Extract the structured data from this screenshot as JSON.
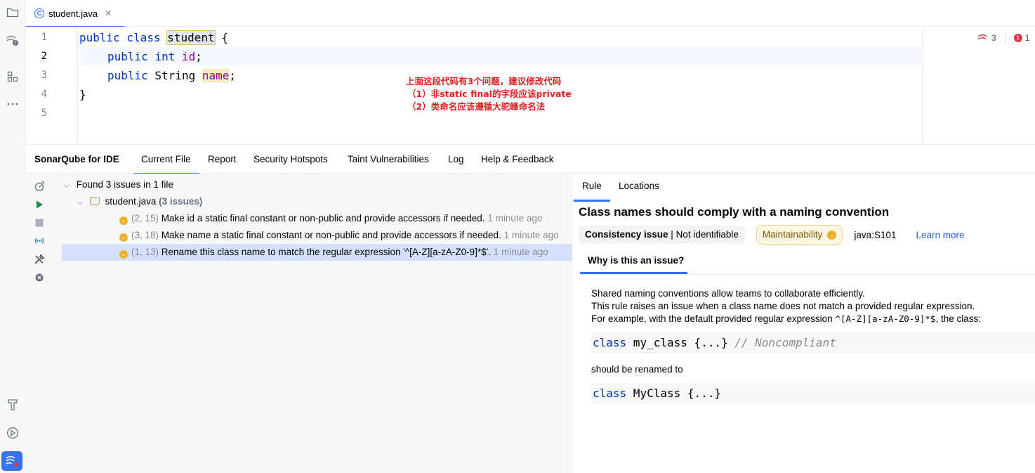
{
  "editor": {
    "tab_label": "student.java",
    "line_numbers": [
      "1",
      "2",
      "3",
      "4",
      "5"
    ],
    "code": {
      "l1_kw1": "public",
      "l1_kw2": "class",
      "l1_name": "student",
      "l1_brace": " {",
      "l2_kw1": "public",
      "l2_kw2": "int",
      "l2_field": "id",
      "l2_semi": ";",
      "l3_kw1": "public",
      "l3_type": " String ",
      "l3_field": "name",
      "l3_semi": ";",
      "l4_close": "}"
    },
    "annotation": [
      "上面这段代码有3个问题，建议修改代码",
      "（1）非static final的字段应该private",
      "（2）类命名应该遵循大驼峰命名法"
    ],
    "inspections": {
      "warnings": "3",
      "errors": "1"
    }
  },
  "tool_window": {
    "title": "SonarQube for IDE",
    "tabs": [
      "Current File",
      "Report",
      "Security Hotspots",
      "Taint Vulnerabilities",
      "Log",
      "Help & Feedback"
    ],
    "tree": {
      "summary": "Found 3 issues in 1 file",
      "file_name": "student.java",
      "file_count": "(3 issues)",
      "issues": [
        {
          "pos": "(2, 15)",
          "message": "Make id a static final constant or non-public and provide accessors if needed.",
          "time": "1 minute ago"
        },
        {
          "pos": "(3, 18)",
          "message": "Make name a static final constant or non-public and provide accessors if needed.",
          "time": "1 minute ago"
        },
        {
          "pos": "(1, 13)",
          "message": "Rename this class name to match the regular expression '^[A-Z][a-zA-Z0-9]*$'.",
          "time": "1 minute ago"
        }
      ]
    }
  },
  "rule_panel": {
    "tabs": [
      "Rule",
      "Locations"
    ],
    "title": "Class names should comply with a naming convention",
    "consistency_label": "Consistency issue",
    "consistency_sep": " | ",
    "consistency_value": "Not identifiable",
    "quality": "Maintainability",
    "rule_key": "java:S101",
    "learn_more": "Learn more",
    "why_tab": "Why is this an issue?",
    "desc_1": "Shared naming conventions allow teams to collaborate efficiently.",
    "desc_2": "This rule raises an issue when a class name does not match a provided regular expression.",
    "desc_3a": "For example, with the default provided regular expression ",
    "desc_3_regex": "^[A-Z][a-zA-Z0-9]*$",
    "desc_3b": ", the class:",
    "code1_kw": "class",
    "code1_rest": " my_class {...} ",
    "code1_comment": "// Noncompliant",
    "renamed_text": "should be renamed to",
    "code2_kw": "class",
    "code2_rest": " MyClass {...}"
  },
  "colors": {
    "accent": "#3574f0",
    "warning": "#e9b02b",
    "error": "#db3b4b",
    "annotation": "#e01e1e"
  }
}
